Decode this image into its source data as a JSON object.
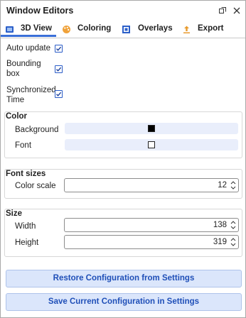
{
  "window": {
    "title": "Window Editors"
  },
  "tabs": [
    {
      "label": "3D View",
      "icon": "cube-icon",
      "active": true
    },
    {
      "label": "Coloring",
      "icon": "palette-icon"
    },
    {
      "label": "Overlays",
      "icon": "overlays-icon"
    },
    {
      "label": "Export",
      "icon": "export-icon"
    }
  ],
  "options": {
    "auto_update": {
      "label": "Auto update",
      "checked": true
    },
    "bounding_box": {
      "label_line1": "Bounding",
      "label_line2": "box",
      "checked": true
    },
    "synchronized_time": {
      "label_line1": "Synchronized",
      "label_line2": "Time",
      "checked": true
    }
  },
  "color": {
    "title": "Color",
    "background": {
      "label": "Background",
      "value": "#000000"
    },
    "font": {
      "label": "Font",
      "value": "#ffffff"
    }
  },
  "font_sizes": {
    "title": "Font sizes",
    "color_scale": {
      "label": "Color scale",
      "value": "12"
    }
  },
  "size": {
    "title": "Size",
    "width": {
      "label": "Width",
      "value": "138"
    },
    "height": {
      "label": "Height",
      "value": "319"
    }
  },
  "buttons": {
    "restore": "Restore Configuration from Settings",
    "save": "Save Current Configuration in Settings"
  },
  "colors": {
    "accent": "#3a6fd8",
    "button_bg": "#dbe6fb",
    "button_text": "#1f4fb8"
  }
}
